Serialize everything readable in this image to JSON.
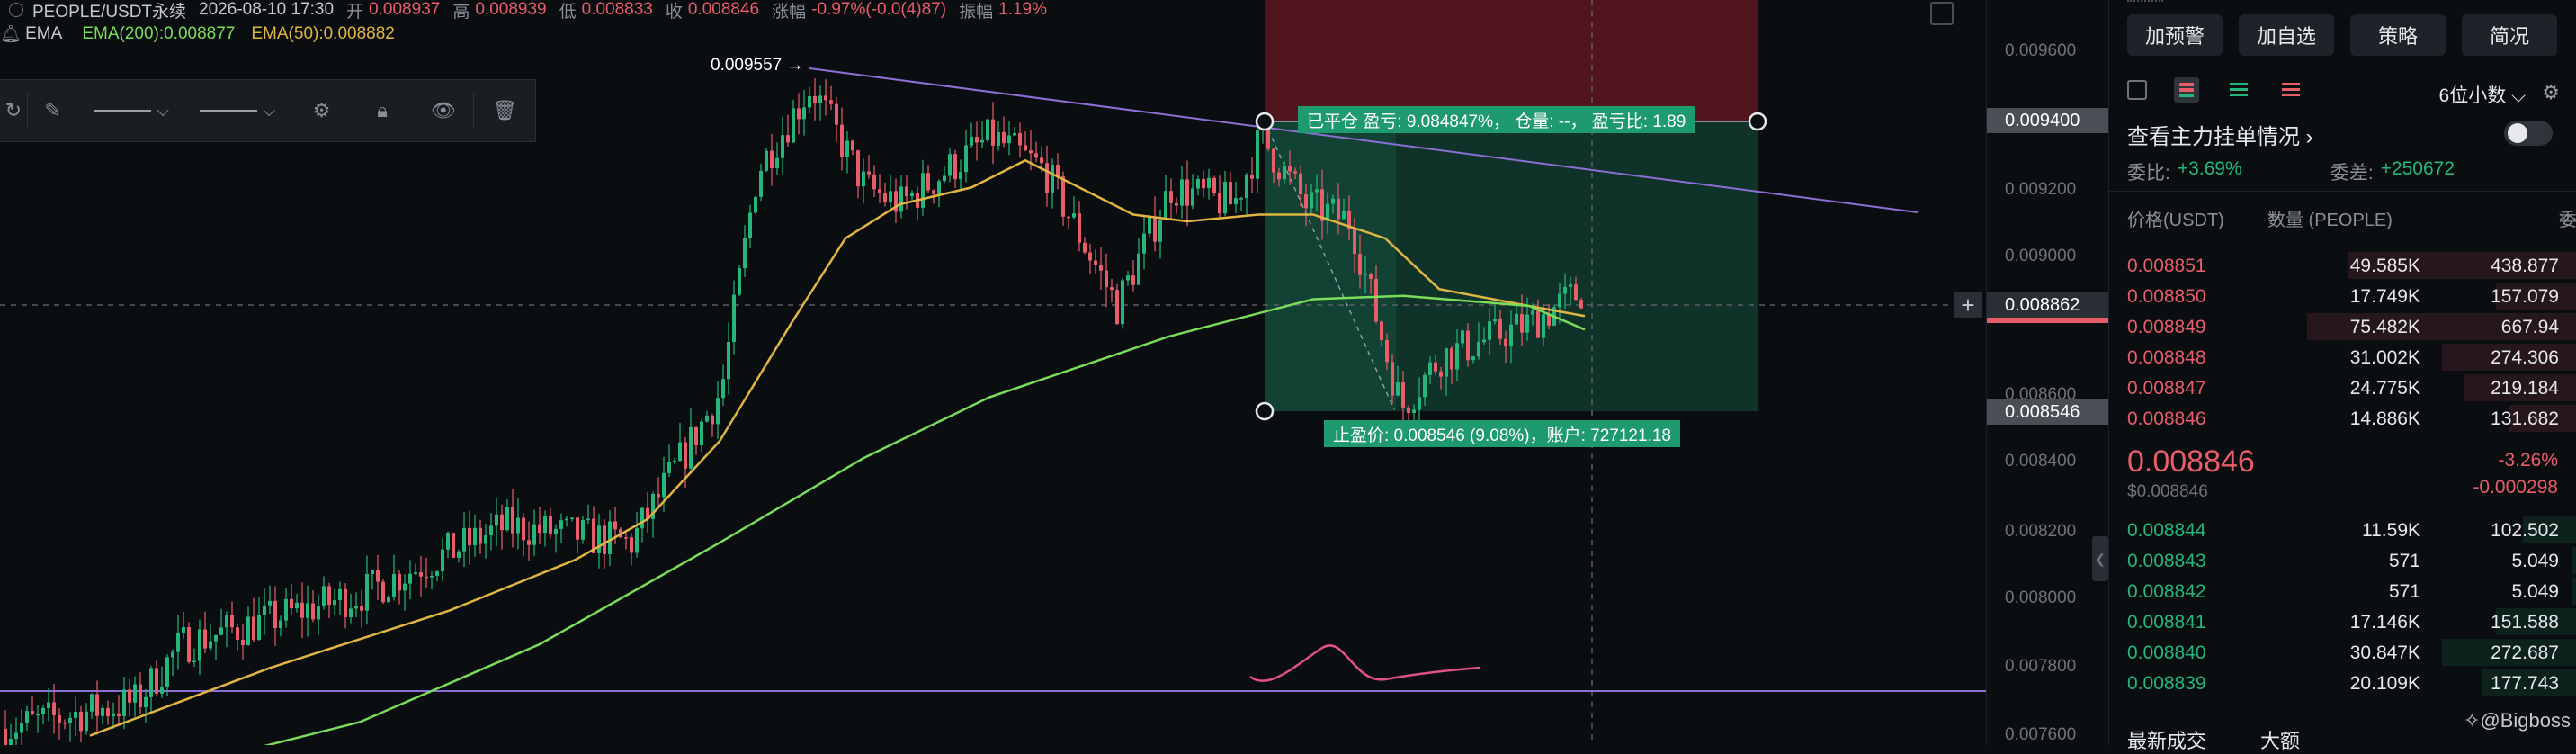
{
  "header": {
    "symbol": "PEOPLE/USDT永续",
    "datetime": "2026-08-10 17:30",
    "open_label": "开",
    "open": "0.008937",
    "high_label": "高",
    "high": "0.008939",
    "low_label": "低",
    "low": "0.008833",
    "close_label": "收",
    "close": "0.008846",
    "change_label": "涨幅",
    "change": "-0.97%(-0.0(4)87)",
    "amp_label": "振幅",
    "amp": "1.19%"
  },
  "ema": {
    "label": "EMA",
    "ema200": "EMA(200):0.008877",
    "ema50": "EMA(50):0.008882",
    "color200": "#7bdc5b",
    "color50": "#e0b544"
  },
  "chart": {
    "high_marker": "0.009557",
    "trade_top_label": "已平仓  盈亏: 9.084847%，  仓量: --，  盈亏比: 1.89",
    "trade_bottom_label": "止盈价: 0.008546 (9.08%)，账户: 727121.18",
    "axis_labels": [
      "0.009600",
      "0.009200",
      "0.009000",
      "0.008800",
      "0.008600",
      "0.008400",
      "0.008200",
      "0.008000",
      "0.007800",
      "0.007600"
    ],
    "tag_top": "0.009400",
    "tag_current": "0.008862",
    "tag_bottom": "0.008546",
    "up_color": "#26b57b",
    "down_color": "#e85d6a"
  },
  "right": {
    "buttons": [
      "加预警",
      "加自选",
      "策略",
      "简况"
    ],
    "precision": "6位小数",
    "depth_title": "查看主力挂单情况",
    "ratio_label": "委比:",
    "ratio_value": "+3.69%",
    "diff_label": "委差:",
    "diff_value": "+250672",
    "col_price": "价格(USDT)",
    "col_qty": "数量 (PEOPLE)",
    "col_amount": "委托额",
    "asks": [
      {
        "p": "0.008851",
        "q": "49.585K",
        "a": "438.877",
        "d": 0.85
      },
      {
        "p": "0.008850",
        "q": "17.749K",
        "a": "157.079",
        "d": 0.3
      },
      {
        "p": "0.008849",
        "q": "75.482K",
        "a": "667.94",
        "d": 1.0
      },
      {
        "p": "0.008848",
        "q": "31.002K",
        "a": "274.306",
        "d": 0.5
      },
      {
        "p": "0.008847",
        "q": "24.775K",
        "a": "219.184",
        "d": 0.42
      },
      {
        "p": "0.008846",
        "q": "14.886K",
        "a": "131.682",
        "d": 0.25
      }
    ],
    "last_price": "0.008846",
    "last_usd": "$0.008846",
    "last_pct": "-3.26%",
    "last_chg": "-0.000298",
    "bids": [
      {
        "p": "0.008844",
        "q": "11.59K",
        "a": "102.502",
        "d": 0.2
      },
      {
        "p": "0.008843",
        "q": "571",
        "a": "5.049",
        "d": 0.02
      },
      {
        "p": "0.008842",
        "q": "571",
        "a": "5.049",
        "d": 0.02
      },
      {
        "p": "0.008841",
        "q": "17.146K",
        "a": "151.588",
        "d": 0.3
      },
      {
        "p": "0.008840",
        "q": "30.847K",
        "a": "272.687",
        "d": 0.5
      },
      {
        "p": "0.008839",
        "q": "20.109K",
        "a": "177.743",
        "d": 0.35
      }
    ],
    "tab_latest": "最新成交",
    "tab_large": "大额",
    "watermark": "@Bigboss"
  }
}
